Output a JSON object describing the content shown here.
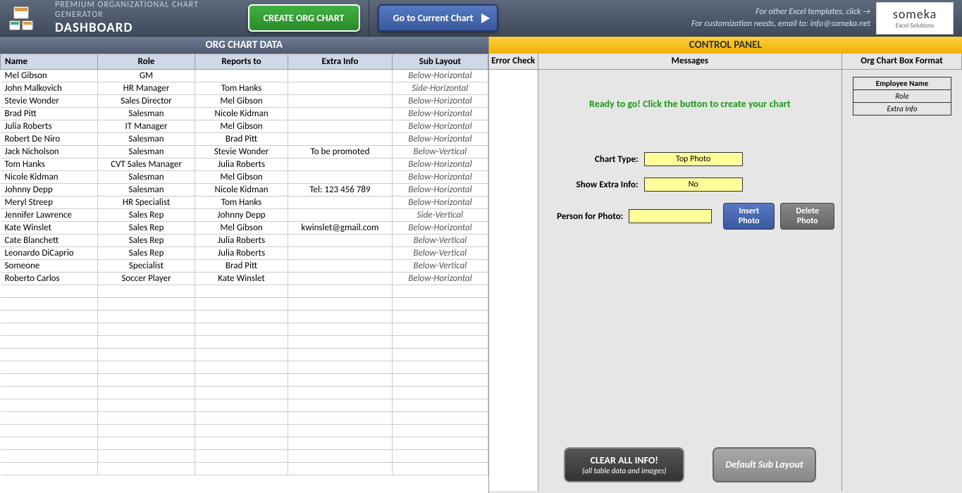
{
  "header": {
    "subtitle": "PREMIUM ORGANIZATIONAL CHART GENERATOR",
    "title": "DASHBOARD",
    "create_btn": "CREATE ORG CHART",
    "goto_btn": "Go to Current Chart",
    "info1": "For other Excel templates, click →",
    "info2": "For customization needs, email to: info@someka.net",
    "logo": "someka",
    "logo_sub": "Excel Solutions"
  },
  "left": {
    "title": "ORG CHART DATA",
    "columns": [
      "Name",
      "Role",
      "Reports to",
      "Extra Info",
      "Sub Layout"
    ],
    "rows": [
      [
        "Mel Gibson",
        "GM",
        "",
        "",
        "Below-Horizontal"
      ],
      [
        "John Malkovich",
        "HR Manager",
        "Tom Hanks",
        "",
        "Side-Horizontal"
      ],
      [
        "Stevie Wonder",
        "Sales Director",
        "Mel Gibson",
        "",
        "Below-Horizontal"
      ],
      [
        "Brad Pitt",
        "Salesman",
        "Nicole Kidman",
        "",
        "Below-Horizontal"
      ],
      [
        "Julia Roberts",
        "IT Manager",
        "Mel Gibson",
        "",
        "Below-Horizontal"
      ],
      [
        "Robert De Niro",
        "Salesman",
        "Brad Pitt",
        "",
        "Below-Horizontal"
      ],
      [
        "Jack Nicholson",
        "Salesman",
        "Stevie Wonder",
        "To be promoted",
        "Below-Vertical"
      ],
      [
        "Tom Hanks",
        "CVT Sales Manager",
        "Julia Roberts",
        "",
        "Below-Horizontal"
      ],
      [
        "Nicole Kidman",
        "Salesman",
        "Mel Gibson",
        "",
        "Below-Horizontal"
      ],
      [
        "Johnny Depp",
        "Salesman",
        "Nicole Kidman",
        "Tel: 123 456 789",
        "Below-Horizontal"
      ],
      [
        "Meryl Streep",
        "HR Specialist",
        "Tom Hanks",
        "",
        "Below-Horizontal"
      ],
      [
        "Jennifer Lawrence",
        "Sales Rep",
        "Johnny Depp",
        "",
        "Side-Vertical"
      ],
      [
        "Kate Winslet",
        "Sales Rep",
        "Mel Gibson",
        "kwinslet@gmail.com",
        "Below-Horizontal"
      ],
      [
        "Cate Blanchett",
        "Sales Rep",
        "Julia Roberts",
        "",
        "Below-Vertical"
      ],
      [
        "Leonardo DiCaprio",
        "Sales Rep",
        "Julia Roberts",
        "",
        "Below-Vertical"
      ],
      [
        "Someone",
        "Specialist",
        "Brad Pitt",
        "",
        "Below-Vertical"
      ],
      [
        "Roberto Carlos",
        "Soccer Player",
        "Kate Winslet",
        "",
        "Below-Horizontal"
      ]
    ],
    "empty_rows": 15
  },
  "right": {
    "title": "CONTROL PANEL",
    "headers": [
      "Error Check",
      "Messages",
      "Org Chart Box Format"
    ],
    "message": "Ready to go! Click the button to create your chart",
    "chart_type_label": "Chart Type:",
    "chart_type_value": "Top Photo",
    "extra_info_label": "Show Extra Info:",
    "extra_info_value": "No",
    "person_label": "Person for Photo:",
    "person_value": "",
    "insert_btn": "Insert Photo",
    "delete_btn": "Delete Photo",
    "clear_btn": "CLEAR ALL INFO!",
    "clear_sub": "(all table data and images)",
    "default_btn": "Default Sub Layout",
    "fmt": [
      "Employee Name",
      "Role",
      "Extra Info"
    ]
  }
}
